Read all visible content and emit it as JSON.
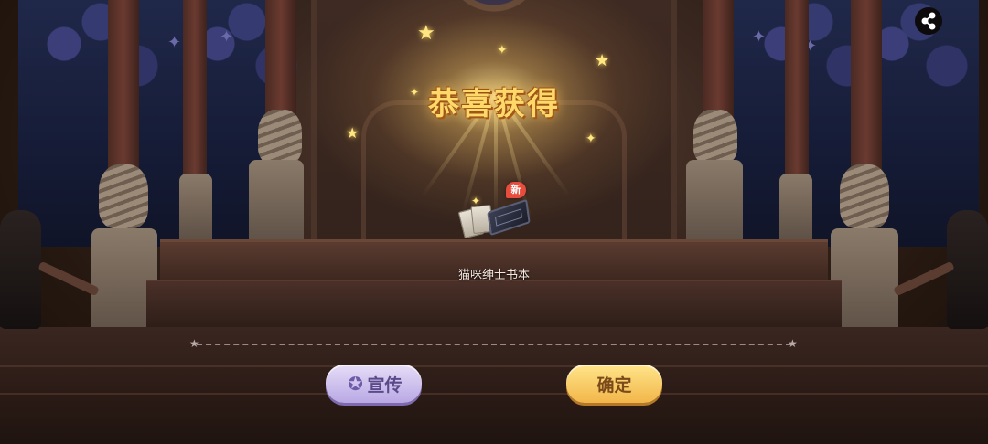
{
  "title": "恭喜获得",
  "item": {
    "name": "猫咪绅士书本",
    "badge": "新"
  },
  "buttons": {
    "promo_label": "宣传",
    "confirm_label": "确定"
  },
  "icons": {
    "share": "share-icon",
    "promo": "star-icon"
  },
  "colors": {
    "title": "#ffd86a",
    "promo_button": "#c9bbe9",
    "confirm_button": "#f7c95c",
    "badge": "#e84c3d"
  }
}
